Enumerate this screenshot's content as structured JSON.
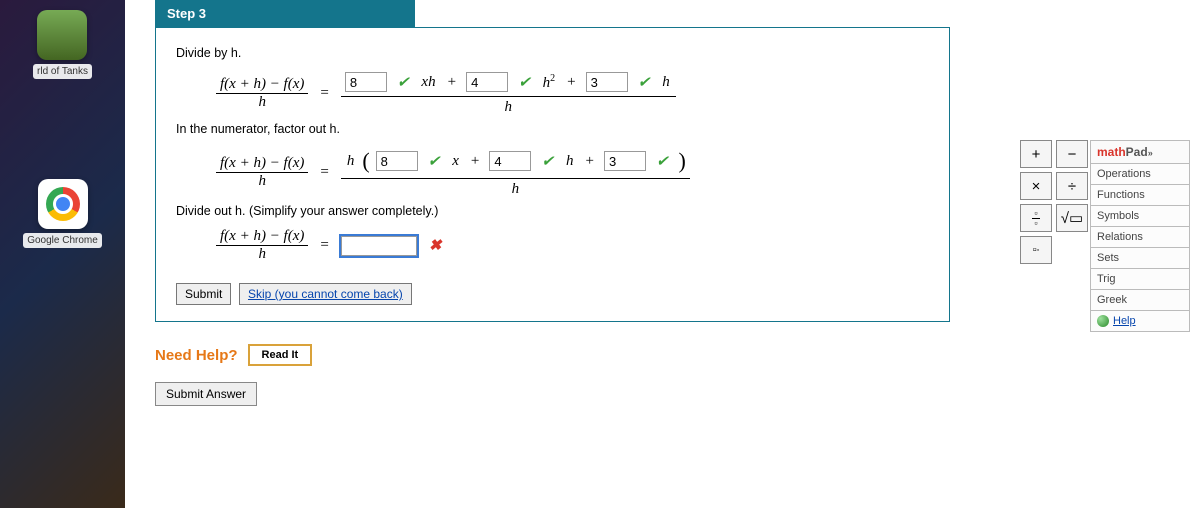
{
  "dock": {
    "tanks_label": "rld of Tanks",
    "chrome_label": "Google Chrome"
  },
  "step": {
    "header": "Step 3",
    "instr1": "Divide by h.",
    "instr2": "In the numerator, factor out h.",
    "instr3": "Divide out h. (Simplify your answer completely.)",
    "lhs_num": "f(x + h) − f(x)",
    "lhs_den": "h",
    "row1": {
      "v1": "8",
      "v2": "4",
      "v3": "3",
      "xh_label": "xh",
      "h2_label": "h",
      "sup": "2",
      "tail_h": "h",
      "plus1": "+",
      "plus2": "+"
    },
    "row2": {
      "v1": "8",
      "v2": "4",
      "v3": "3",
      "x_label": "x",
      "h_label": "h",
      "plus1": "+",
      "plus2": "+",
      "factor_h": "h",
      "paren_open": "(",
      "paren_close": ")"
    },
    "row3": {
      "value": ""
    },
    "big_den": "h",
    "eq": "="
  },
  "controls": {
    "submit": "Submit",
    "skip": "Skip (you cannot come back)",
    "submit_answer": "Submit Answer"
  },
  "help": {
    "label": "Need Help?",
    "read_it": "Read It"
  },
  "mathpad": {
    "title_math": "math",
    "title_pad": "Pad",
    "title_sym": "»",
    "plus": "+",
    "minus": "−",
    "times": "×",
    "divide": "÷",
    "frac": "▭⁄▭",
    "sqrt": "√▭",
    "exp": "▭▫",
    "cats": {
      "operations": "Operations",
      "functions": "Functions",
      "symbols": "Symbols",
      "relations": "Relations",
      "sets": "Sets",
      "trig": "Trig",
      "greek": "Greek"
    },
    "help": "Help"
  }
}
